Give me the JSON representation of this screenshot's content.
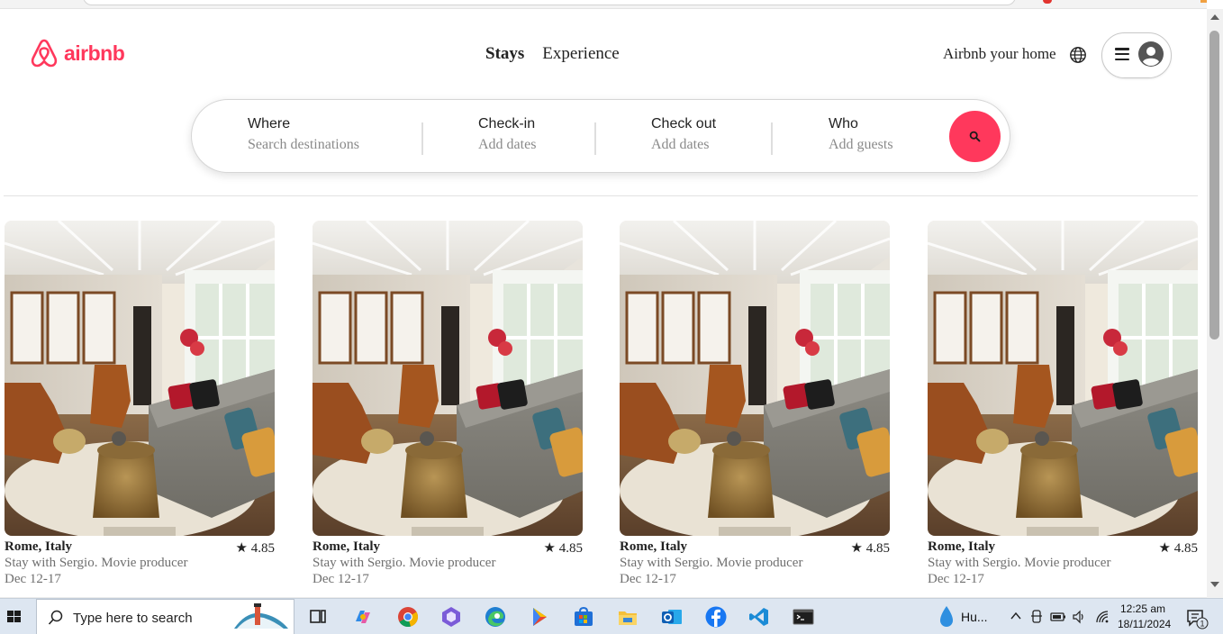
{
  "brand": {
    "name": "airbnb",
    "color": "#ff385c"
  },
  "nav": {
    "tabs": [
      {
        "label": "Stays"
      },
      {
        "label": "Experience"
      }
    ]
  },
  "header": {
    "host_link": "Airbnb your home"
  },
  "search": {
    "where_label": "Where",
    "where_placeholder": "Search destinations",
    "checkin_label": "Check-in",
    "checkin_placeholder": "Add dates",
    "checkout_label": "Check out",
    "checkout_placeholder": "Add dates",
    "who_label": "Who",
    "who_placeholder": "Add guests"
  },
  "listings": [
    {
      "title": "Rome, Italy",
      "rating": "4.85",
      "description": "Stay with Sergio. Movie producer",
      "dates": "Dec 12-17"
    },
    {
      "title": "Rome, Italy",
      "rating": "4.85",
      "description": "Stay with Sergio. Movie producer",
      "dates": "Dec 12-17"
    },
    {
      "title": "Rome, Italy",
      "rating": "4.85",
      "description": "Stay with Sergio. Movie producer",
      "dates": "Dec 12-17"
    },
    {
      "title": "Rome, Italy",
      "rating": "4.85",
      "description": "Stay with Sergio. Movie producer",
      "dates": "Dec 12-17"
    }
  ],
  "taskbar": {
    "search_placeholder": "Type here to search",
    "weather": "Hu...",
    "time": "12:25 am",
    "date": "18/11/2024",
    "notification_count": "1",
    "apps": [
      "task-view",
      "copilot",
      "chrome",
      "microsoft-365",
      "edge",
      "play-store",
      "microsoft-store",
      "file-explorer",
      "outlook",
      "facebook",
      "vs-code",
      "terminal"
    ]
  }
}
